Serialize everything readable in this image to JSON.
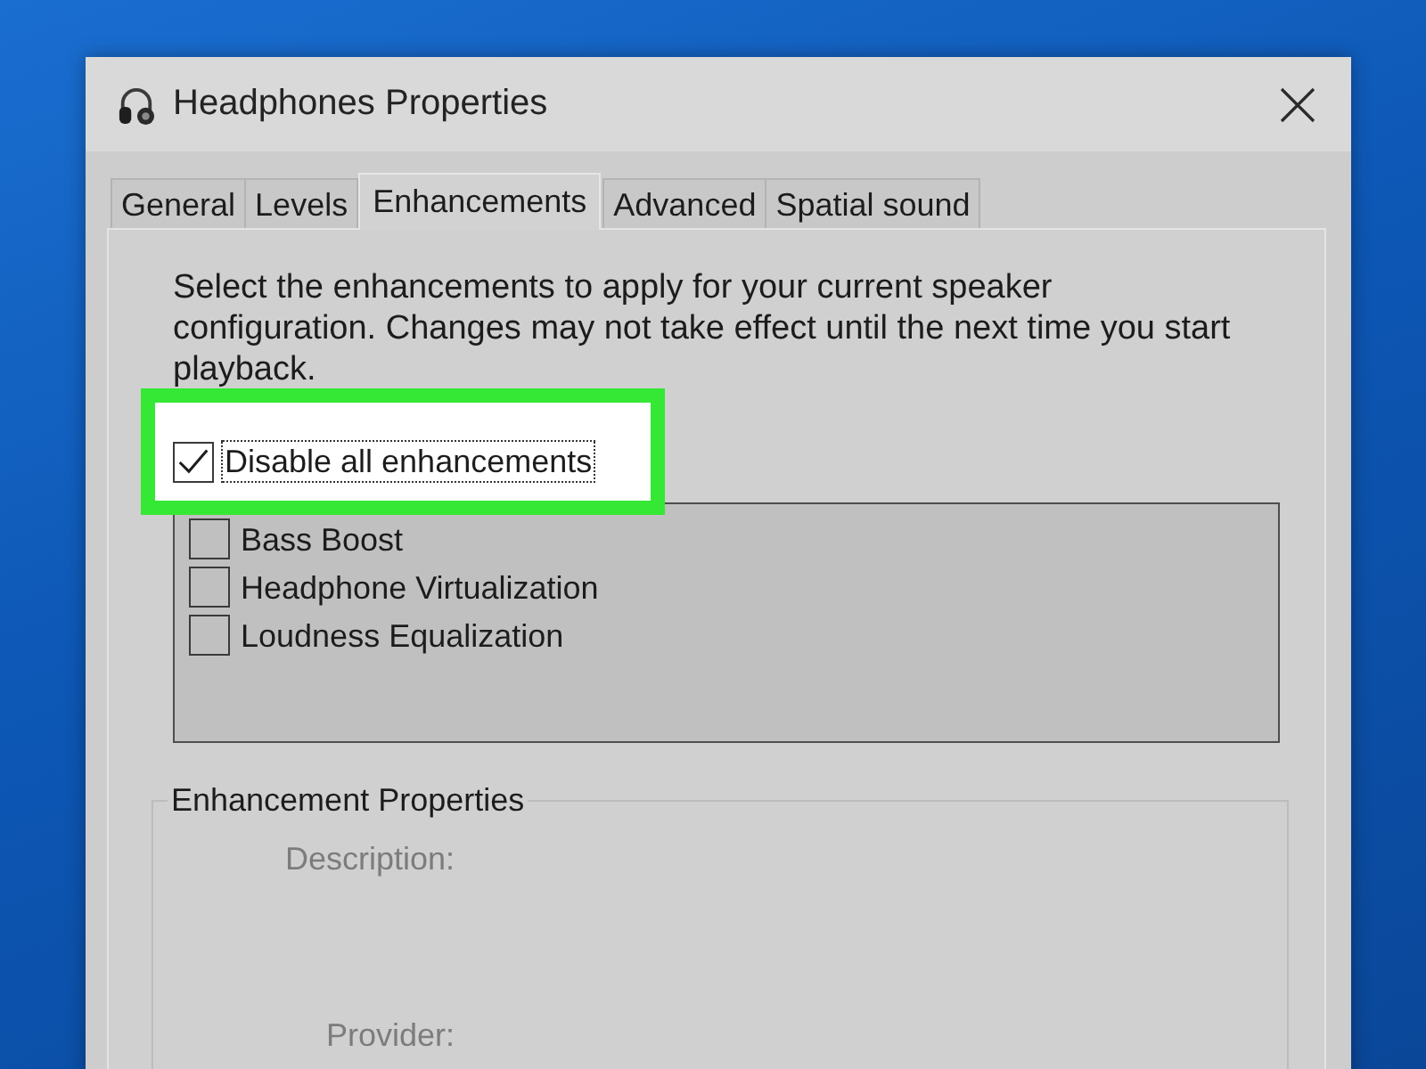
{
  "window": {
    "title": "Headphones Properties"
  },
  "tabs": [
    {
      "label": "General",
      "selected": false
    },
    {
      "label": "Levels",
      "selected": false
    },
    {
      "label": "Enhancements",
      "selected": true
    },
    {
      "label": "Advanced",
      "selected": false
    },
    {
      "label": "Spatial sound",
      "selected": false
    }
  ],
  "description": "Select the enhancements to apply for your current speaker configuration. Changes may not take effect until the next time you start playback.",
  "disable_all": {
    "label": "Disable all enhancements",
    "checked": true,
    "focused": true,
    "highlighted": true
  },
  "enhancements": {
    "disabled": true,
    "items": [
      {
        "label": "Bass Boost",
        "checked": false
      },
      {
        "label": "Headphone Virtualization",
        "checked": false
      },
      {
        "label": "Loudness Equalization",
        "checked": false
      }
    ]
  },
  "enhancement_properties": {
    "title": "Enhancement Properties",
    "fields": [
      {
        "label": "Description:",
        "disabled": true
      },
      {
        "label": "Provider:",
        "disabled": true
      }
    ]
  }
}
